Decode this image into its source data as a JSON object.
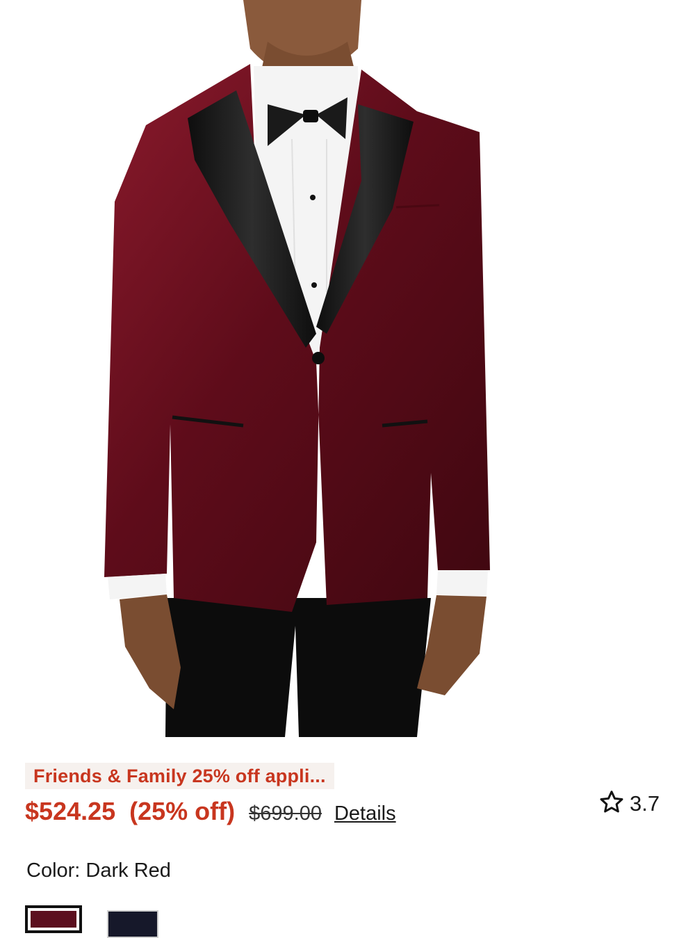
{
  "product": {
    "image_alt": "Men's dark red velvet tuxedo jacket with black satin peak lapels",
    "promo_text": "Friends & Family 25% off appli...",
    "sale_price": "$524.25",
    "discount": "(25% off)",
    "original_price": "$699.00",
    "details_link": "Details",
    "rating_icon": "star-outline-icon",
    "rating": "3.7",
    "color_label": "Color: Dark Red",
    "swatches": [
      {
        "name": "Dark Red",
        "color": "#5c0f1f",
        "selected": true
      },
      {
        "name": "Navy",
        "color": "#16182a",
        "selected": false
      }
    ]
  },
  "colors": {
    "accent": "#c8361f",
    "promo_bg": "#f6f1ee",
    "jacket": "#6b0f1e",
    "lapel": "#141414"
  }
}
